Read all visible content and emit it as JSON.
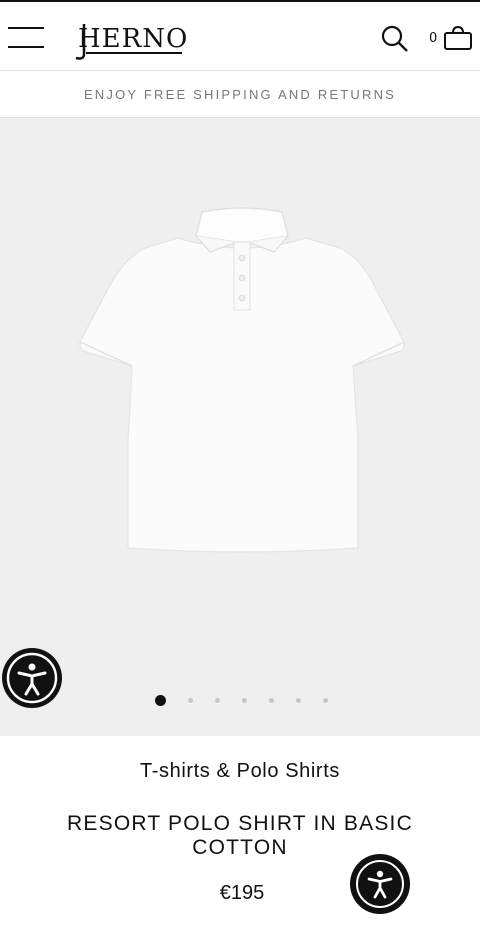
{
  "header": {
    "logo_text": "HERNO",
    "cart_count": "0",
    "menu_icon": "hamburger-menu-icon",
    "search_icon": "search-icon",
    "cart_icon": "shopping-bag-icon"
  },
  "promo": {
    "text": "ENJOY FREE SHIPPING AND RETURNS"
  },
  "gallery": {
    "background": "#efefef",
    "image": "white-polo-shirt",
    "dot_count": 7,
    "active_index": 0
  },
  "product": {
    "category": "T-shirts & Polo Shirts",
    "title": "RESORT POLO SHIRT IN BASIC COTTON",
    "price": "€195"
  },
  "accessibility": {
    "icon": "accessibility-icon"
  }
}
